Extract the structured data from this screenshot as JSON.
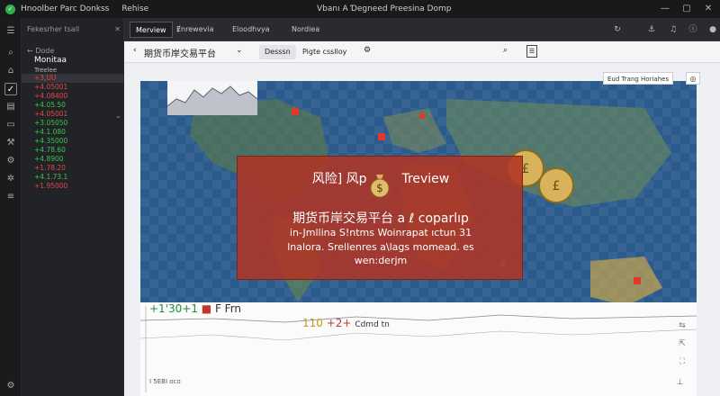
{
  "titlebar": {
    "app_name": "Hnoolber Parc Donkss",
    "menu": "Rehise",
    "center_title": "Vbanı A Ɗegneed  Preesina Domp",
    "minimize": "—",
    "maximize": "▢",
    "close": "✕"
  },
  "sidebar": {
    "search_label": "Fekesrher tsall",
    "search_close": "✕",
    "nav_label": "← Dode",
    "heading": "Monitaa",
    "subheading": "Treelee",
    "items": [
      {
        "label": "+3,UU",
        "color": "red"
      },
      {
        "label": "+4.05001",
        "color": "red"
      },
      {
        "label": "+4.08400",
        "color": "red"
      },
      {
        "label": "+4.05.50",
        "color": "green"
      },
      {
        "label": "+4.05001",
        "color": "red"
      },
      {
        "label": "+3.05050",
        "color": "green"
      },
      {
        "label": "+4.1.080",
        "color": "green"
      },
      {
        "label": "+4.35000",
        "color": "green"
      },
      {
        "label": "+4.78.60",
        "color": "green"
      },
      {
        "label": "+4.8900",
        "color": "green"
      },
      {
        "label": "+1.78.20",
        "color": "red"
      },
      {
        "label": "+4.1.73.1",
        "color": "green"
      },
      {
        "label": "+1.95000",
        "color": "red"
      }
    ]
  },
  "tabs": {
    "items": [
      {
        "label": "Merview",
        "active": true
      },
      {
        "label": "Ɇnrewevia",
        "active": false
      },
      {
        "label": "Eloodhvya",
        "active": false
      },
      {
        "label": "Nordiea",
        "active": false
      }
    ]
  },
  "toolbar": {
    "title": "期货币岸交易平台",
    "pill_active": "Desssn",
    "pill_other": "Pigte csslloy"
  },
  "map": {
    "ctl_label": "Eud Trang  Horiahes",
    "ctl_icon": "◎"
  },
  "modal": {
    "title_prefix": "风险] 风p",
    "title_suffix": "Treview",
    "line1": "期货币岸交易平台  a ℓ coparlıp",
    "line2": "in-Jmllina  S!ntms  Woinrapat ıctun 31",
    "line3": "lnalora. Srellenres a\\lags momead. es",
    "line4": "wen:derjm"
  },
  "legend": {
    "l1_green": "+1'30+1",
    "l1_red": "■",
    "l1_grey": "F Frn",
    "l2_yellow": "110",
    "l2_red": "+2+",
    "l2_grey": "Cdmd tn"
  },
  "footer": {
    "left": "I 5EBI oco",
    "right": "⊥"
  },
  "colors": {
    "accent_red": "#b0342b",
    "up_green": "#37c44a",
    "down_red": "#e5463f",
    "map_ocean": "#2b5a8c"
  }
}
